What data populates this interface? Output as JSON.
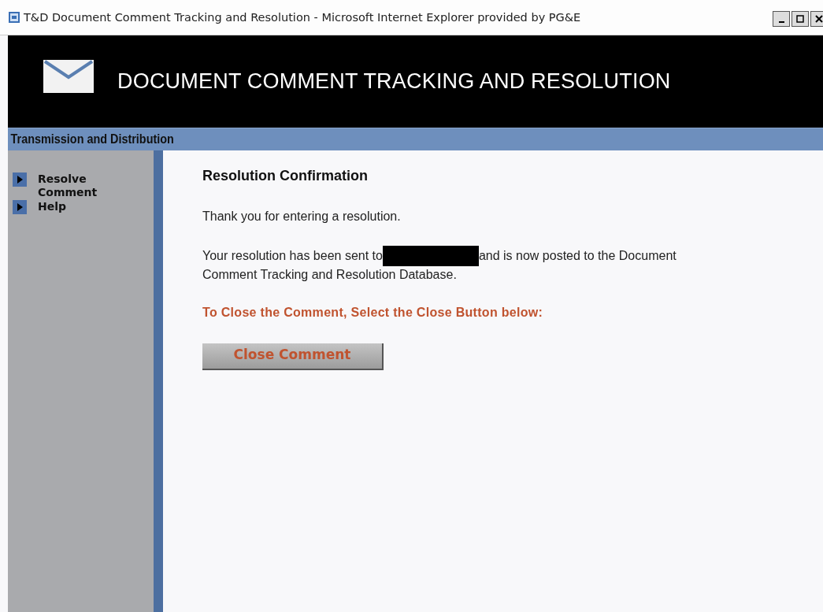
{
  "window": {
    "title": "T&D Document Comment Tracking and Resolution - Microsoft Internet Explorer provided by PG&E"
  },
  "header": {
    "title": "DOCUMENT COMMENT TRACKING AND RESOLUTION"
  },
  "banner": {
    "text": "Transmission and Distribution"
  },
  "sidebar": {
    "items": [
      {
        "label": "Resolve Comment"
      },
      {
        "label": "Help"
      }
    ]
  },
  "content": {
    "heading": "Resolution Confirmation",
    "paragraphs": [
      {
        "kind": "plain",
        "text": "Thank you for entering a resolution."
      },
      {
        "kind": "redacted",
        "before": "Your resolution has been sent to",
        "after_lines": [
          "and is now posted to the Document",
          "Comment Tracking and Resolution Database."
        ]
      }
    ],
    "instruction": "To Close the Comment, Select the Close Button below:",
    "button": "Close Comment"
  }
}
